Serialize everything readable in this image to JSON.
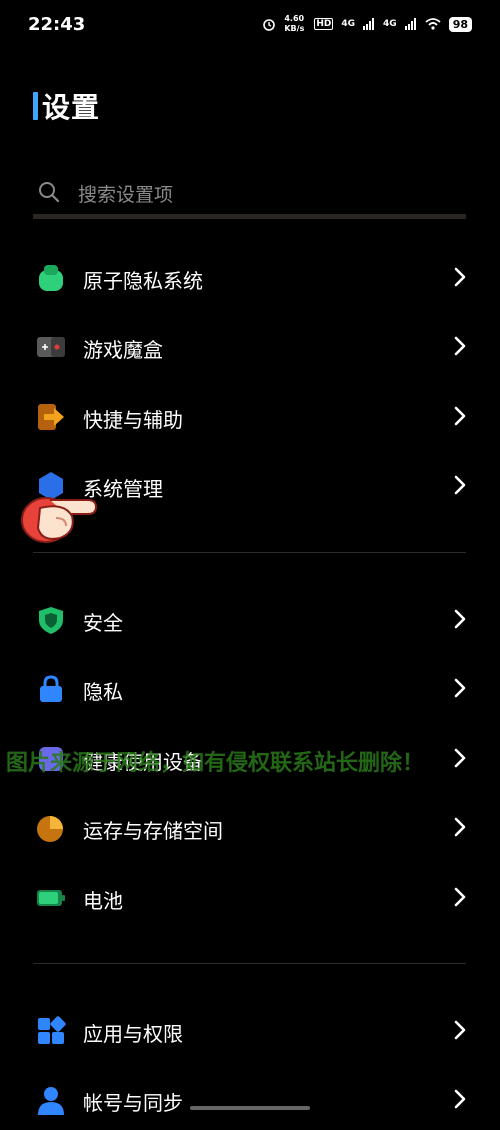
{
  "status_bar": {
    "time": "22:43",
    "speed": "4.60 KB/s",
    "hd": "HD",
    "net1": "4G",
    "net2": "4G",
    "battery": "98"
  },
  "page": {
    "title": "设置"
  },
  "search": {
    "placeholder": "搜索设置项"
  },
  "groups": [
    {
      "items": [
        {
          "label": "原子隐私系统",
          "icon": "atom-privacy-icon",
          "color": "#2fd07c"
        },
        {
          "label": "游戏魔盒",
          "icon": "game-box-icon",
          "color": "#5a5a5a"
        },
        {
          "label": "快捷与辅助",
          "icon": "shortcut-icon",
          "color": "#f2a21b"
        },
        {
          "label": "系统管理",
          "icon": "system-manage-icon",
          "color": "#2b6fe8"
        }
      ]
    },
    {
      "items": [
        {
          "label": "安全",
          "icon": "security-shield-icon",
          "color": "#1fbf6a"
        },
        {
          "label": "隐私",
          "icon": "privacy-lock-icon",
          "color": "#2f86ff"
        },
        {
          "label": "健康使用设备",
          "icon": "health-usage-icon",
          "color": "#6a6ae8"
        },
        {
          "label": "运存与存储空间",
          "icon": "storage-icon",
          "color": "#f29a1b"
        },
        {
          "label": "电池",
          "icon": "battery-icon",
          "color": "#2fd07c"
        }
      ]
    },
    {
      "items": [
        {
          "label": "应用与权限",
          "icon": "apps-icon",
          "color": "#2f86ff"
        },
        {
          "label": "帐号与同步",
          "icon": "account-icon",
          "color": "#2f86ff"
        }
      ]
    }
  ],
  "overlay": {
    "watermark": "图片来源于网络，如有侵权联系站长删除！"
  }
}
